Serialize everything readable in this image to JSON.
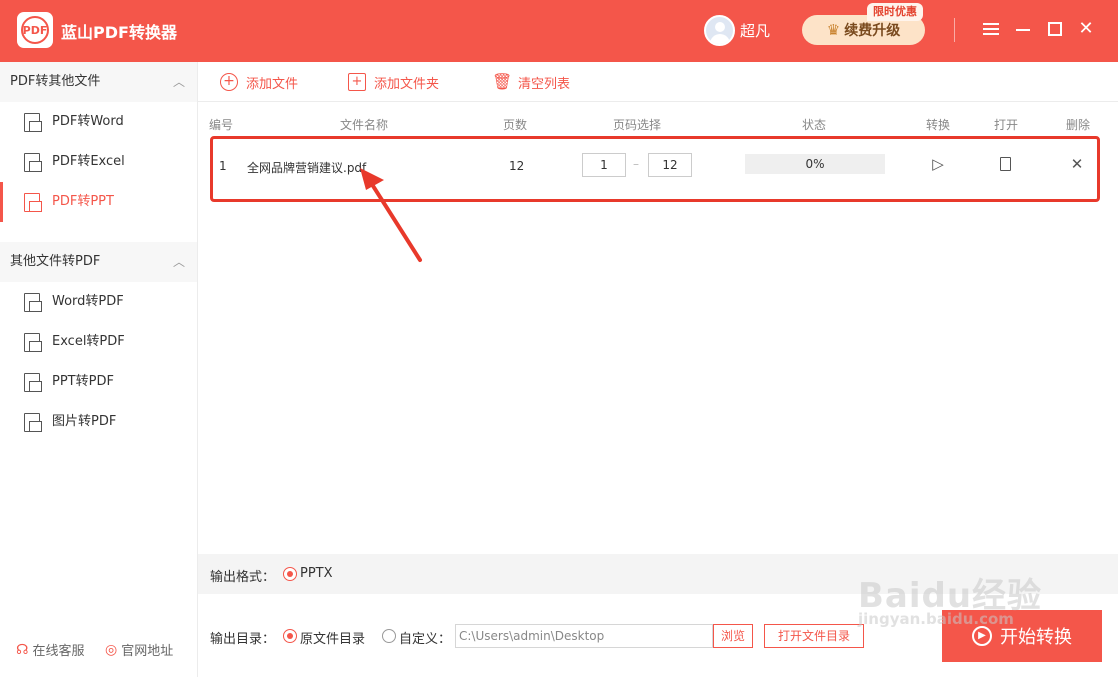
{
  "app": {
    "title": "蓝山PDF转换器",
    "logo_text": "PDF"
  },
  "user": {
    "name": "超凡"
  },
  "upgrade": {
    "label": "续费升级",
    "promo_tag": "限时优惠"
  },
  "sidebar": {
    "groups": [
      {
        "label": "PDF转其他文件",
        "items": [
          "PDF转Word",
          "PDF转Excel",
          "PDF转PPT"
        ]
      },
      {
        "label": "其他文件转PDF",
        "items": [
          "Word转PDF",
          "Excel转PDF",
          "PPT转PDF",
          "图片转PDF"
        ]
      }
    ],
    "active_item": "PDF转PPT",
    "footer": {
      "service": "在线客服",
      "website": "官网地址"
    }
  },
  "toolbar": {
    "add_file": "添加文件",
    "add_folder": "添加文件夹",
    "clear_list": "清空列表"
  },
  "table": {
    "columns": {
      "index": "编号",
      "name": "文件名称",
      "pages": "页数",
      "range": "页码选择",
      "status": "状态",
      "convert": "转换",
      "open": "打开",
      "delete": "删除"
    },
    "rows": [
      {
        "index": "1",
        "name": "全网品牌营销建议.pdf",
        "pages": "12",
        "range_from": "1",
        "range_to": "12",
        "progress": "0%"
      }
    ]
  },
  "output": {
    "format_label": "输出格式：",
    "format_value": "PPTX",
    "dir_label": "输出目录：",
    "dir_option_original": "原文件目录",
    "dir_option_custom": "自定义：",
    "dir_path": "C:\\Users\\admin\\Desktop",
    "browse": "浏览",
    "open_dir": "打开文件目录"
  },
  "start_button": "开始转换",
  "watermark": {
    "line1": "Baidu经验",
    "line2": "jingyan.baidu.com"
  },
  "colors": {
    "accent": "#f4564a",
    "highlight_border": "#e8392b"
  }
}
